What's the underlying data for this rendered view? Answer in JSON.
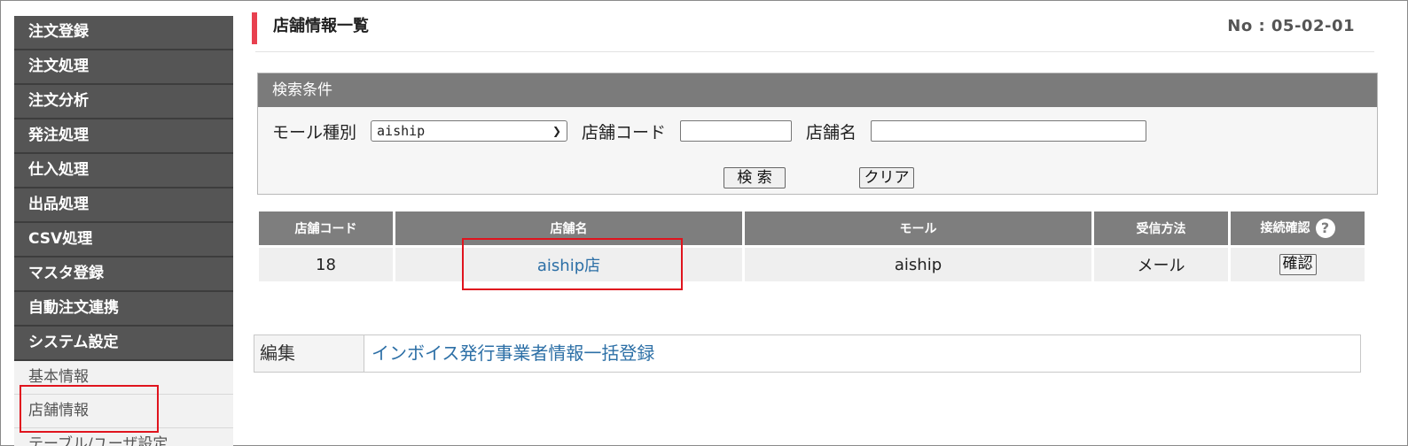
{
  "sidebar": {
    "menu": [
      "注文登録",
      "注文処理",
      "注文分析",
      "発注処理",
      "仕入処理",
      "出品処理",
      "CSV処理",
      "マスタ登録",
      "自動注文連携",
      "システム設定"
    ],
    "sub": [
      "基本情報",
      "店舗情報",
      "テーブル/ユーザ設定"
    ]
  },
  "header": {
    "title": "店舗情報一覧",
    "page_no": "No : 05-02-01"
  },
  "search": {
    "heading": "検索条件",
    "mall_label": "モール種別",
    "mall_value": "aiship",
    "code_label": "店舗コード",
    "code_value": "",
    "name_label": "店舗名",
    "name_value": "",
    "search_button": "検 索",
    "clear_button": "クリア"
  },
  "table": {
    "headers": [
      "店舗コード",
      "店舗名",
      "モール",
      "受信方法",
      "接続確認"
    ],
    "rows": [
      {
        "code": "18",
        "name": "aiship店",
        "mall": "aiship",
        "method": "メール",
        "confirm": "確認"
      }
    ]
  },
  "edit": {
    "label": "編集",
    "link": "インボイス発行事業者情報一括登録"
  },
  "icons": {
    "help": "help-icon",
    "dropdown": "chevron-down-icon"
  },
  "colors": {
    "highlight": "#e0141e",
    "accent": "#e8404f",
    "link": "#2c6fa6"
  }
}
